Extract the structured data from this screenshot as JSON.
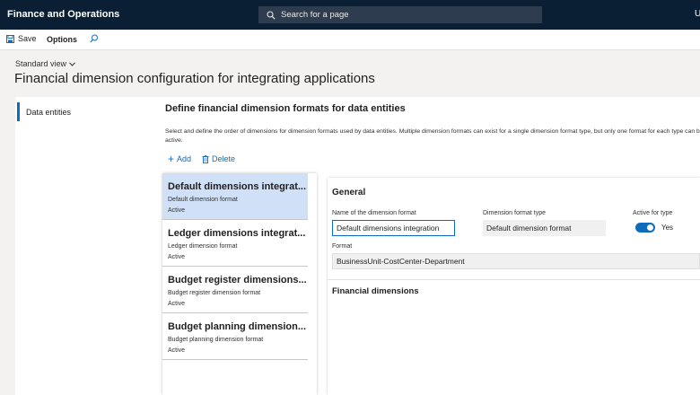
{
  "app": {
    "title": "Finance and Operations",
    "search_placeholder": "Search for a page",
    "user_initial": "U"
  },
  "actionbar": {
    "save_label": "Save",
    "options_label": "Options"
  },
  "page": {
    "view_label": "Standard view",
    "title": "Financial dimension configuration for integrating applications"
  },
  "leftnav": {
    "items": [
      {
        "label": "Data entities",
        "selected": true
      }
    ]
  },
  "section": {
    "title": "Define financial dimension formats for data entities",
    "description": "Select and define the order of dimensions for dimension formats used by data entities. Multiple dimension formats can exist for a single dimension format type, but only one format for each type can be active.",
    "add_label": "Add",
    "delete_label": "Delete"
  },
  "formats": [
    {
      "title": "Default dimensions integrat...",
      "type": "Default dimension format",
      "status": "Active",
      "selected": true
    },
    {
      "title": "Ledger dimensions integrat...",
      "type": "Ledger dimension format",
      "status": "Active",
      "selected": false
    },
    {
      "title": "Budget register dimensions...",
      "type": "Budget register dimension format",
      "status": "Active",
      "selected": false
    },
    {
      "title": "Budget planning dimension...",
      "type": "Budget planning dimension format",
      "status": "Active",
      "selected": false
    }
  ],
  "detail": {
    "general_title": "General",
    "name_label": "Name of the dimension format",
    "name_value": "Default dimensions integration",
    "type_label": "Dimension format type",
    "type_value": "Default dimension format",
    "active_label": "Active for type",
    "active_value": "Yes",
    "format_label": "Format",
    "format_value": "BusinessUnit-CostCenter-Department",
    "financial_dimensions_title": "Financial dimensions"
  },
  "colors": {
    "topbar": "#0a1f33",
    "accent": "#0f6cbd",
    "selected_row": "#cfe0f7"
  }
}
